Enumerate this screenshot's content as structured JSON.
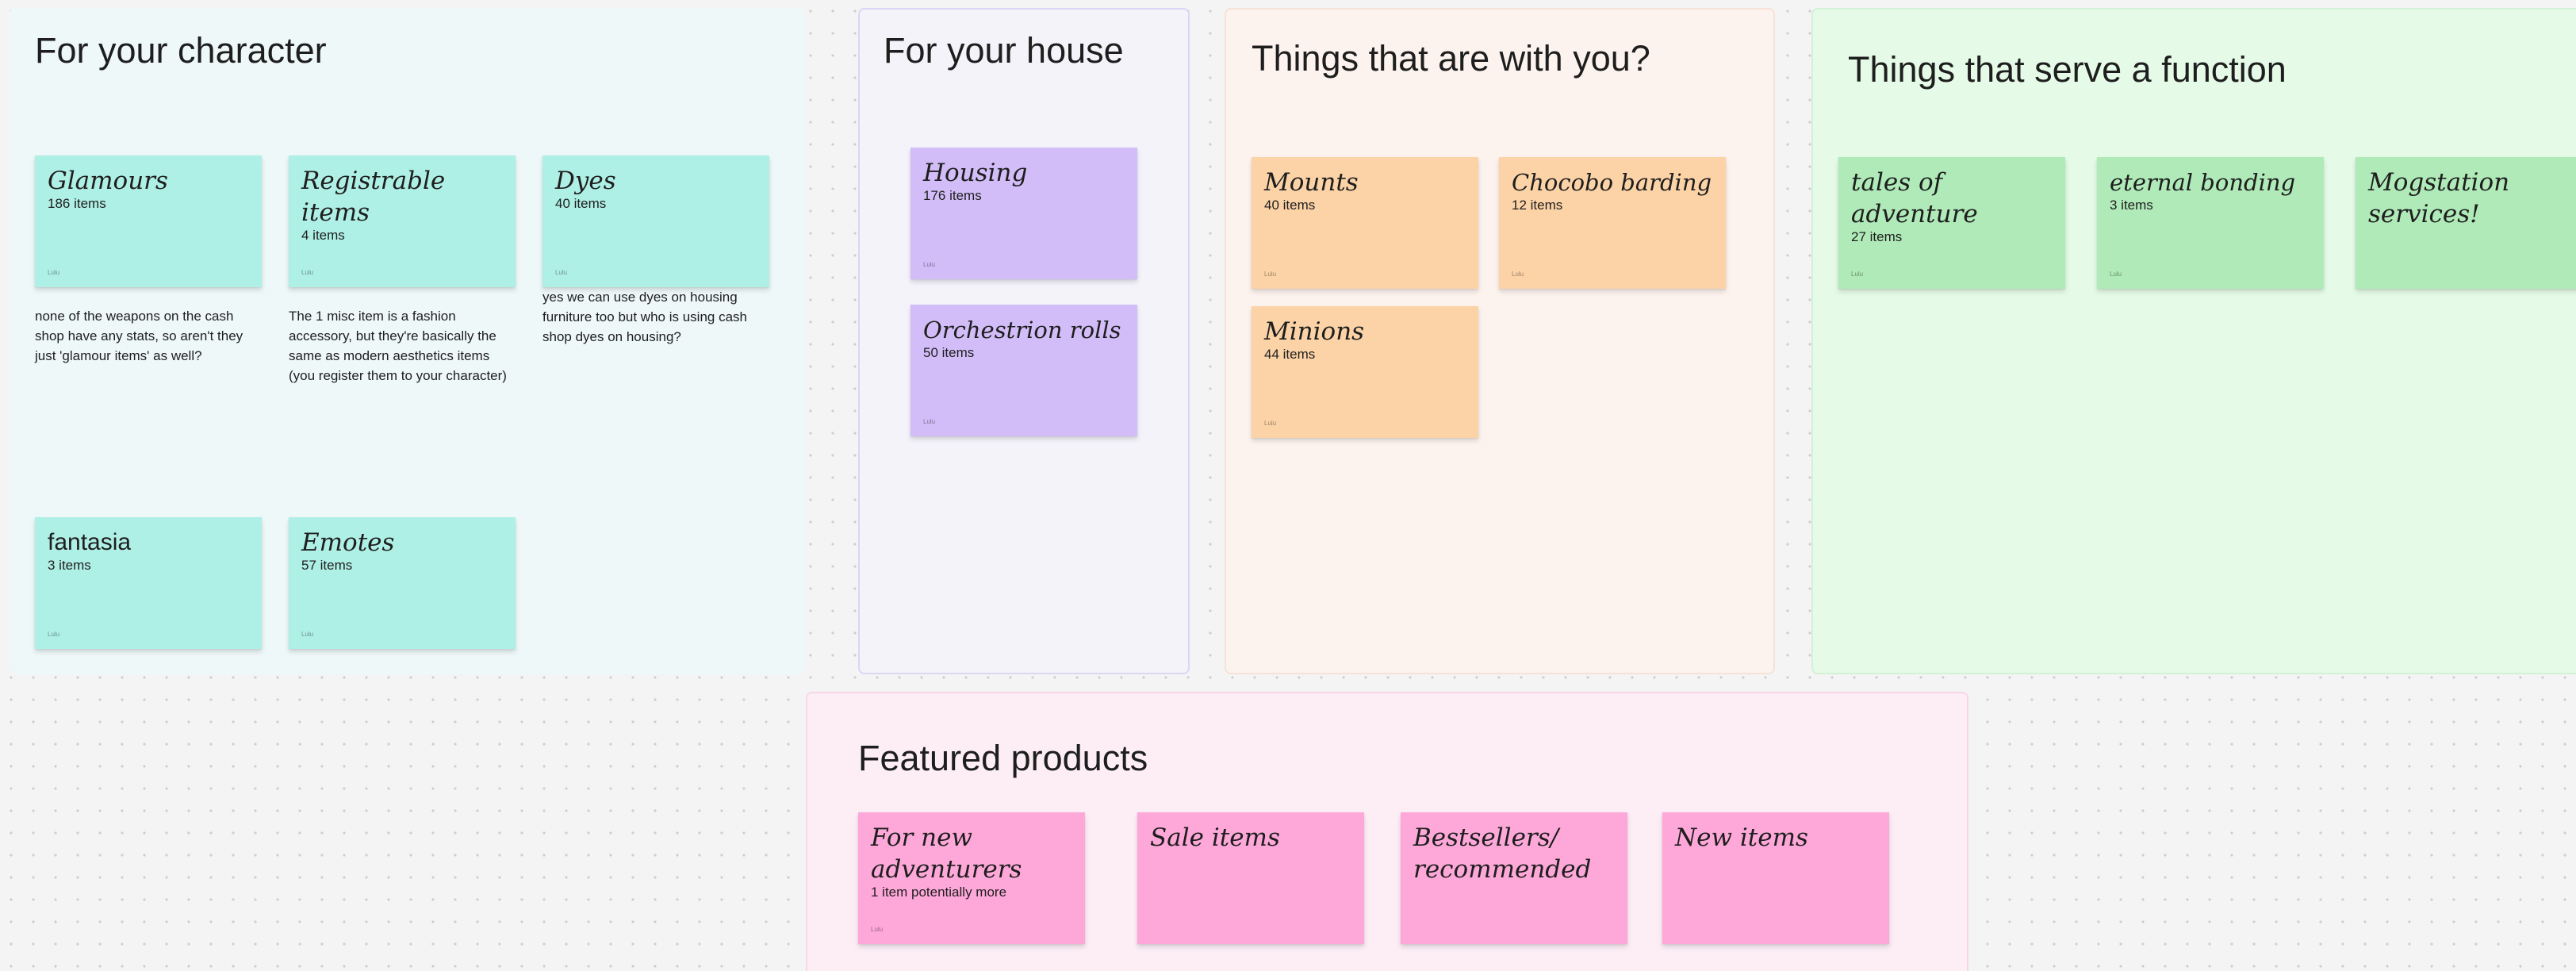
{
  "colors": {
    "character_section_bg": "#eef8f9",
    "house_section_bg": "#f4f3fa",
    "with_you_section_bg": "#fdf3ee",
    "function_section_bg": "#e5fbe7",
    "featured_section_bg": "#fdeef6",
    "teal_sticky": "#aff0e6",
    "purple_sticky": "#d3bdf8",
    "orange_sticky": "#fcd3a7",
    "green_sticky": "#afeab8",
    "pink_sticky": "#fea8d9"
  },
  "sections": {
    "character": {
      "title": "For your character",
      "stickies": [
        {
          "title": "Glamours",
          "count": "186 items",
          "author": "Lulu"
        },
        {
          "title": "Registrable items",
          "count": "4 items",
          "author": "Lulu"
        },
        {
          "title": "Dyes",
          "count": "40 items",
          "author": "Lulu"
        },
        {
          "title": "fantasia",
          "count": "3 items",
          "author": "Lulu"
        },
        {
          "title": "Emotes",
          "count": "57 items",
          "author": "Lulu"
        }
      ],
      "notes": [
        "none of the weapons on the cash shop have any stats, so aren't they just 'glamour items' as well?",
        "The 1 misc item is a fashion accessory, but they're basically the same as modern aesthetics items (you register them to your character)",
        "yes we can use dyes on housing furniture too but who is using cash shop dyes on housing?"
      ]
    },
    "house": {
      "title": "For your house",
      "stickies": [
        {
          "title": "Housing",
          "count": "176 items",
          "author": "Lulu"
        },
        {
          "title": "Orchestrion rolls",
          "count": "50 items",
          "author": "Lulu"
        }
      ]
    },
    "with_you": {
      "title": "Things that are with you?",
      "stickies": [
        {
          "title": "Mounts",
          "count": "40 items",
          "author": "Lulu"
        },
        {
          "title": "Chocobo barding",
          "count": "12 items",
          "author": "Lulu"
        },
        {
          "title": "Minions",
          "count": "44 items",
          "author": "Lulu"
        }
      ]
    },
    "function": {
      "title": "Things that serve a function",
      "stickies": [
        {
          "title": "tales of adventure",
          "count": "27 items",
          "author": "Lulu"
        },
        {
          "title": "eternal bonding",
          "count": "3 items",
          "author": "Lulu"
        },
        {
          "title": "Mogstation services!",
          "count": "",
          "author": ""
        }
      ]
    },
    "featured": {
      "title": "Featured products",
      "stickies": [
        {
          "title": "For new adventurers",
          "count": "1 item potentially more",
          "author": "Lulu"
        },
        {
          "title": "Sale items",
          "count": "",
          "author": ""
        },
        {
          "title": "Bestsellers/ recommended",
          "count": "",
          "author": ""
        },
        {
          "title": "New items",
          "count": "",
          "author": ""
        }
      ]
    }
  }
}
